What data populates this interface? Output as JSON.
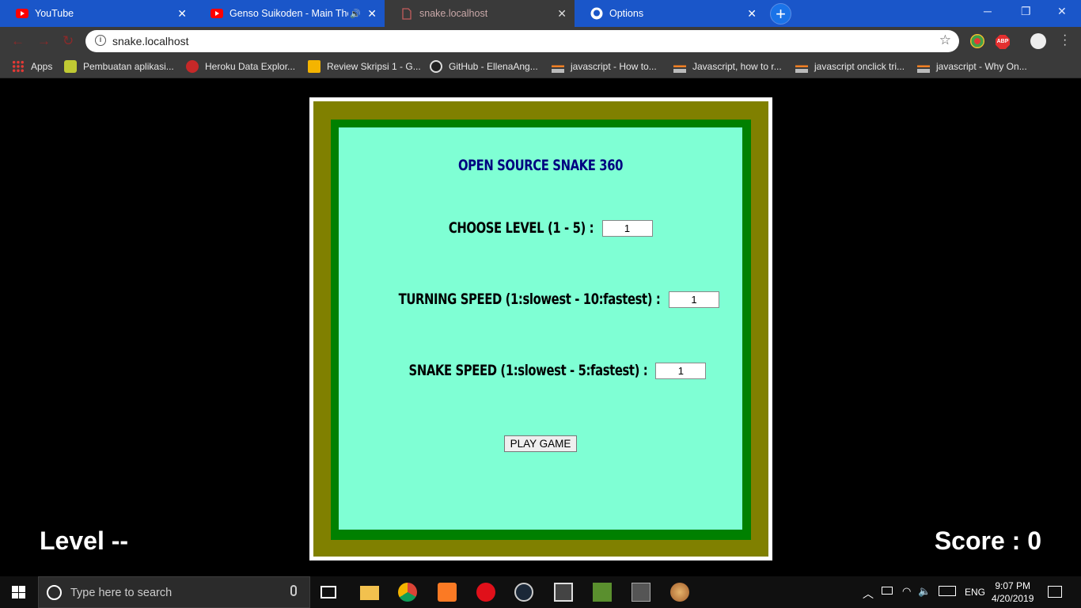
{
  "browser": {
    "tabs": [
      {
        "title": "YouTube",
        "icon": "youtube-icon",
        "active": false
      },
      {
        "title": "Genso Suikoden - Main Then",
        "icon": "youtube-icon",
        "active": false,
        "audio": true
      },
      {
        "title": "snake.localhost",
        "icon": "page-icon",
        "active": true
      },
      {
        "title": "Options",
        "icon": "github-icon",
        "active": false
      }
    ],
    "address": "snake.localhost",
    "abp_label": "ABP",
    "bookmarks": [
      {
        "label": "Apps",
        "icon": "apps-grid-icon"
      },
      {
        "label": "Pembuatan aplikasi...",
        "icon": "android-icon"
      },
      {
        "label": "Heroku Data Explor...",
        "icon": "heroku-icon"
      },
      {
        "label": "Review Skripsi 1 - G...",
        "icon": "slides-icon"
      },
      {
        "label": "GitHub - EllenaAng...",
        "icon": "github-icon"
      },
      {
        "label": "javascript - How to...",
        "icon": "stackoverflow-icon"
      },
      {
        "label": "Javascript, how to r...",
        "icon": "stackoverflow-icon"
      },
      {
        "label": "javascript onclick tri...",
        "icon": "stackoverflow-icon"
      },
      {
        "label": "javascript - Why On...",
        "icon": "stackoverflow-icon"
      }
    ]
  },
  "game": {
    "title": "OPEN SOURCE SNAKE 360",
    "level_label": "CHOOSE LEVEL (1 - 5) :",
    "level_value": "1",
    "turning_label": "TURNING SPEED (1:slowest - 10:fastest) :",
    "turning_value": "1",
    "speed_label": "SNAKE SPEED (1:slowest - 5:fastest) :",
    "speed_value": "1",
    "play_label": "PLAY GAME",
    "level_status": "Level --",
    "score_status": "Score : 0",
    "colors": {
      "outer": "#808000",
      "mid": "#008000",
      "inner": "#7fffd4",
      "title": "#000080"
    }
  },
  "taskbar": {
    "search_placeholder": "Type here to search",
    "language": "ENG",
    "time": "9:07 PM",
    "date": "4/20/2019"
  }
}
